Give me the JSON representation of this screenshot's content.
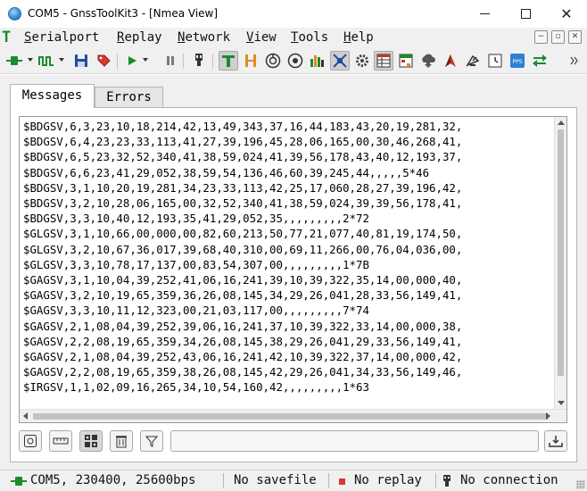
{
  "window": {
    "title": "COM5 - GnssToolKit3 - [Nmea View]",
    "controls": {
      "minimize": "minimize",
      "maximize": "maximize",
      "close": "✕"
    }
  },
  "menu": {
    "items": [
      "Serialport",
      "Replay",
      "Network",
      "View",
      "Tools",
      "Help"
    ],
    "mdi_buttons": [
      "−",
      "▫",
      "✕"
    ]
  },
  "toolbar": {
    "icons": [
      "serial-connect-icon",
      "waveform-icon",
      "save-icon",
      "tag-icon",
      "play-icon",
      "pause-icon",
      "usb-plug-icon",
      "text-view-icon",
      "h-view-icon",
      "compass-icon",
      "target-icon",
      "bar-chart-icon",
      "satellite-icon",
      "gear-icon",
      "table-icon",
      "table-color-icon",
      "cloud-download-icon",
      "antenna-icon",
      "satellite-dish-icon",
      "clock-icon",
      "pps-icon",
      "swap-arrows-icon",
      "overflow-chevron-icon"
    ],
    "active": [
      "text-view-icon"
    ],
    "pps_label": "PPS"
  },
  "tabs": [
    {
      "label": "Messages",
      "active": true
    },
    {
      "label": "Errors",
      "active": false
    }
  ],
  "log": {
    "lines": [
      "$BDGSV,6,3,23,10,18,214,42,13,49,343,37,16,44,183,43,20,19,281,32,",
      "$BDGSV,6,4,23,23,33,113,41,27,39,196,45,28,06,165,00,30,46,268,41,",
      "$BDGSV,6,5,23,32,52,340,41,38,59,024,41,39,56,178,43,40,12,193,37,",
      "$BDGSV,6,6,23,41,29,052,38,59,54,136,46,60,39,245,44,,,,,5*46",
      "$BDGSV,3,1,10,20,19,281,34,23,33,113,42,25,17,060,28,27,39,196,42,",
      "$BDGSV,3,2,10,28,06,165,00,32,52,340,41,38,59,024,39,39,56,178,41,",
      "$BDGSV,3,3,10,40,12,193,35,41,29,052,35,,,,,,,,,2*72",
      "$GLGSV,3,1,10,66,00,000,00,82,60,213,50,77,21,077,40,81,19,174,50,",
      "$GLGSV,3,2,10,67,36,017,39,68,40,310,00,69,11,266,00,76,04,036,00,",
      "$GLGSV,3,3,10,78,17,137,00,83,54,307,00,,,,,,,,,1*7B",
      "$GAGSV,3,1,10,04,39,252,41,06,16,241,39,10,39,322,35,14,00,000,40,",
      "$GAGSV,3,2,10,19,65,359,36,26,08,145,34,29,26,041,28,33,56,149,41,",
      "$GAGSV,3,3,10,11,12,323,00,21,03,117,00,,,,,,,,,7*74",
      "$GAGSV,2,1,08,04,39,252,39,06,16,241,37,10,39,322,33,14,00,000,38,",
      "$GAGSV,2,2,08,19,65,359,34,26,08,145,38,29,26,041,29,33,56,149,41,",
      "$GAGSV,2,1,08,04,39,252,43,06,16,241,42,10,39,322,37,14,00,000,42,",
      "$GAGSV,2,2,08,19,65,359,38,26,08,145,42,29,26,041,34,33,56,149,46,",
      "$IRGSV,1,1,02,09,16,265,34,10,54,160,42,,,,,,,,,1*63"
    ]
  },
  "bottom_bar": {
    "buttons": [
      "filter-view-icon",
      "ruler-icon",
      "grid-select-icon",
      "trash-icon",
      "funnel-icon"
    ],
    "command_value": "",
    "send_icon": "download-tray-icon"
  },
  "status": {
    "connection": "COM5, 230400, 25600bps",
    "savefile": "No savefile",
    "replay": "No replay",
    "network": "No connection"
  },
  "colors": {
    "accent_green": "#1e8a2e",
    "replay_red": "#d9382e",
    "active_toolbar": "#cfcfcf"
  }
}
